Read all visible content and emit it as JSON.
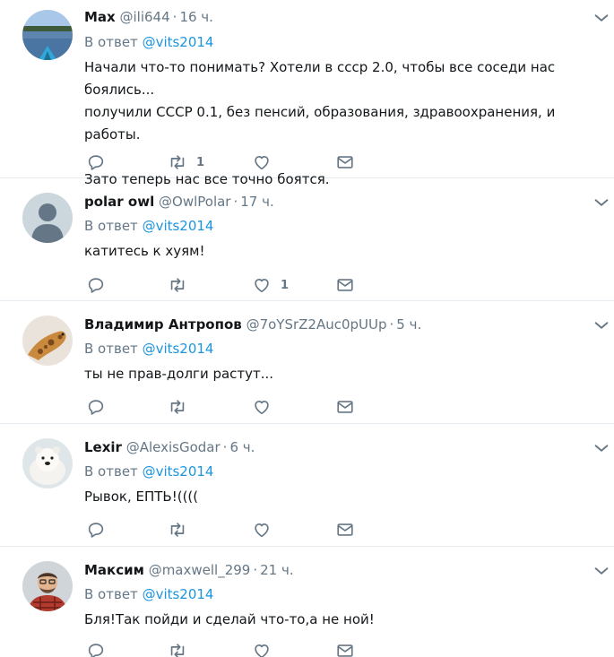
{
  "reply_prefix": "В ответ",
  "tweets": [
    {
      "name": "Max",
      "handle": "@ili644",
      "time": "16 ч.",
      "reply_to": "@vits2014",
      "text": "Начали что-то понимать? Хотели в ссср 2.0, чтобы все соседи нас боялись...\nполучили СССР 0.1, без пенсий, образования, здравоохранения, и работы.\n\nЗато теперь нас все точно боятся.",
      "retweets": "1",
      "likes": "",
      "avatar": "lake-boat-avatar"
    },
    {
      "name": "polar owl",
      "handle": "@OwlPolar",
      "time": "17 ч.",
      "reply_to": "@vits2014",
      "text": "катитесь к хуям!",
      "retweets": "",
      "likes": "1",
      "avatar": "default-avatar"
    },
    {
      "name": "Владимир Антропов",
      "handle": "@7oYSrZ2Auc0pUUp",
      "time": "5 ч.",
      "reply_to": "@vits2014",
      "text": "ты не прав-долги растут...",
      "retweets": "",
      "likes": "",
      "avatar": "giraffe-avatar"
    },
    {
      "name": "Lexir",
      "handle": "@AlexisGodar",
      "time": "6 ч.",
      "reply_to": "@vits2014",
      "text": "Рывок, ЕПТЬ!((((",
      "retweets": "",
      "likes": "",
      "avatar": "polar-bear-avatar"
    },
    {
      "name": "Максим",
      "handle": "@maxwell_299",
      "time": "21 ч.",
      "reply_to": "@vits2014",
      "text": "Бля!Так пойди и сделай что-то,а не ной!",
      "retweets": "",
      "likes": "",
      "avatar": "man-photo-avatar"
    }
  ],
  "colors": {
    "link": "#1b95e0",
    "secondary_text": "#657786",
    "icon": "#657786",
    "divider": "#e6ecf0"
  },
  "icons": [
    "reply-icon",
    "retweet-icon",
    "like-icon",
    "direct-message-icon",
    "chevron-down-icon"
  ]
}
